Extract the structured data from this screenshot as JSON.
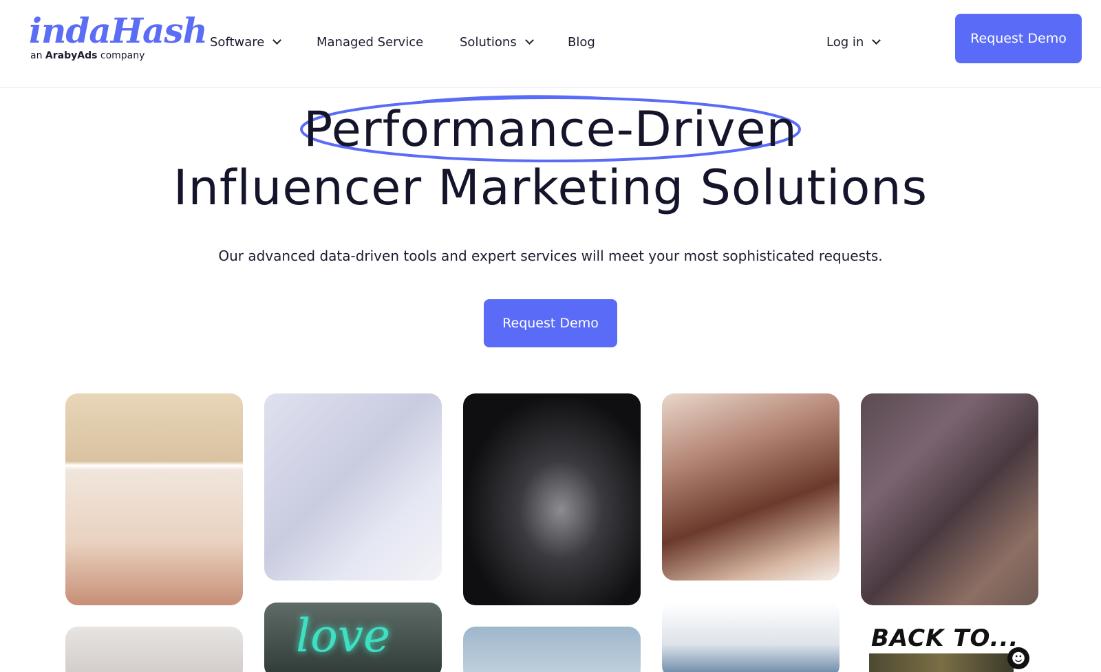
{
  "logo": {
    "main": "indaHash",
    "sub_prefix": "an ",
    "sub_brand": "ArabyAds",
    "sub_suffix": " company"
  },
  "nav": {
    "items": [
      {
        "label": "Software",
        "has_dropdown": true
      },
      {
        "label": "Managed Service",
        "has_dropdown": false
      },
      {
        "label": "Solutions",
        "has_dropdown": true
      },
      {
        "label": "Blog",
        "has_dropdown": false
      }
    ],
    "login": {
      "label": "Log in",
      "has_dropdown": true
    },
    "cta": "Request Demo"
  },
  "hero": {
    "title_line1": "Performance-Driven",
    "title_line2": "Influencer Marketing Solutions",
    "subtitle": "Our advanced data-driven tools and expert services will meet your most sophisticated requests.",
    "cta": "Request Demo"
  },
  "gallery": {
    "overlay_love": "love",
    "overlay_back": "BACK TO..."
  },
  "colors": {
    "accent": "#5a6cf7",
    "text": "#14142b",
    "background": "#ffffff"
  },
  "icons": [
    "chevron-down-icon",
    "cookie-settings-icon"
  ]
}
